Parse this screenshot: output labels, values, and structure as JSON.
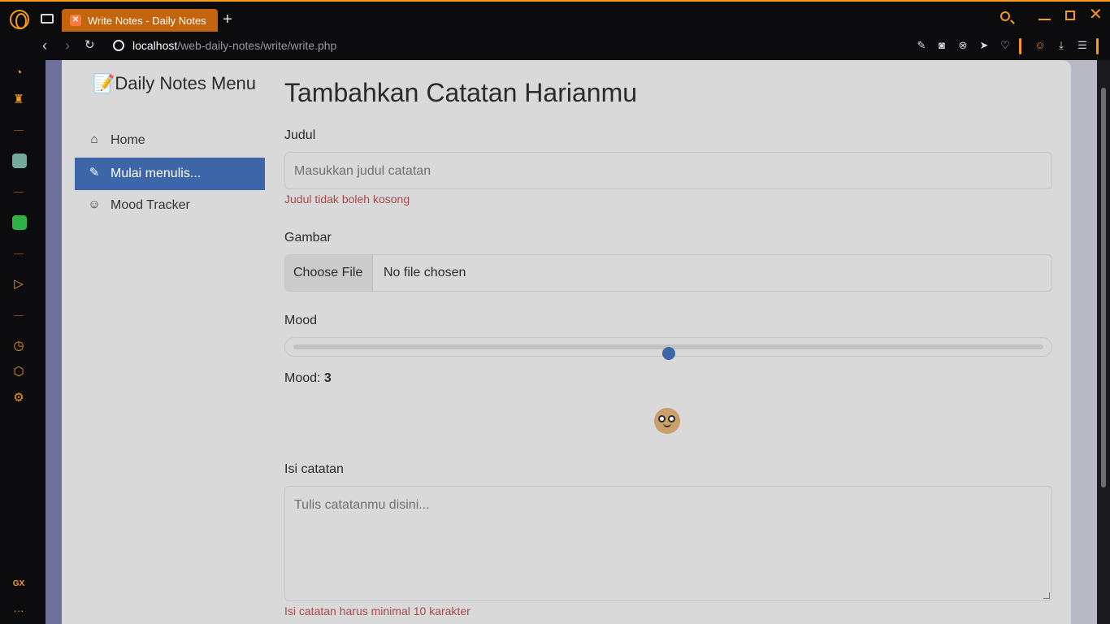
{
  "browser": {
    "tab_title": "Write Notes - Daily Notes",
    "new_tab_label": "+",
    "url_host": "localhost",
    "url_path": "/web-daily-notes/write/write.php",
    "gx_label": "GX",
    "more_label": "···",
    "accent_color": "#f79b1c"
  },
  "menu": {
    "title": "📝Daily Notes Menu",
    "items": [
      {
        "label": "Home",
        "icon": "home-icon",
        "active": false
      },
      {
        "label": "Mulai menulis...",
        "icon": "pencil-icon",
        "active": true
      },
      {
        "label": "Mood Tracker",
        "icon": "smiley-icon",
        "active": false
      }
    ]
  },
  "form": {
    "title": "Tambahkan Catatan Harianmu",
    "judul": {
      "label": "Judul",
      "placeholder": "Masukkan judul catatan",
      "error": "Judul tidak boleh kosong"
    },
    "gambar": {
      "label": "Gambar",
      "button_label": "Choose File",
      "status": "No file chosen"
    },
    "mood": {
      "label": "Mood",
      "readout_prefix": "Mood: ",
      "value": "3",
      "slider_fraction": 0.5
    },
    "isi": {
      "label": "Isi catatan",
      "placeholder": "Tulis catatanmu disini...",
      "error": "Isi catatan harus minimal 10 karakter"
    }
  }
}
